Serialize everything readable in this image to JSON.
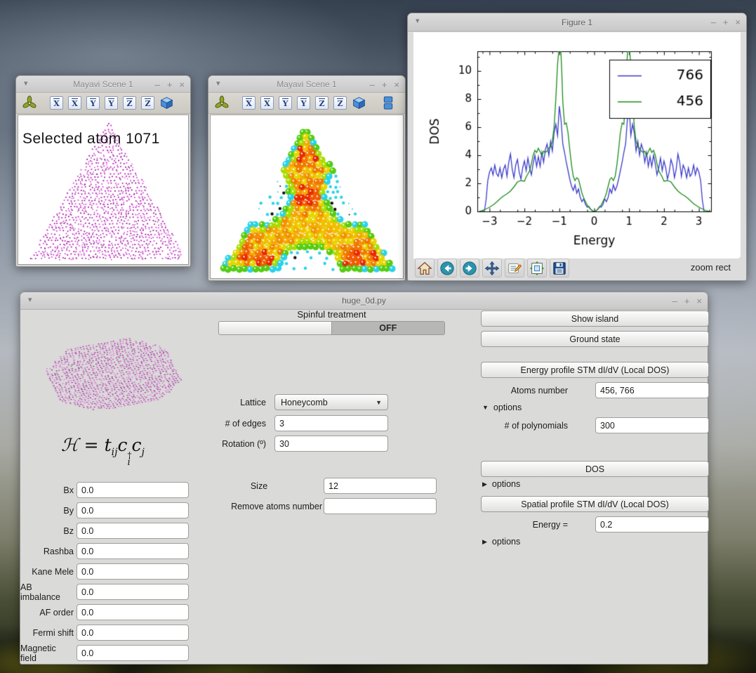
{
  "icons": {
    "minimize": "–",
    "maximize": "+",
    "close": "×",
    "menu": "▾",
    "expander_open": "▼",
    "expander_closed": "▶",
    "combo_arrow": "▼"
  },
  "mayavi1": {
    "title": "Mayavi Scene 1",
    "scene_text": "Selected atom 1071",
    "axis_letters": [
      "X",
      "X",
      "Y",
      "Y",
      "Z",
      "Z"
    ],
    "dot_color": "#c315c3"
  },
  "mayavi2": {
    "title": "Mayavi Scene 1",
    "axis_letters": [
      "X",
      "X",
      "Y",
      "Y",
      "Z",
      "Z"
    ]
  },
  "figure": {
    "title": "Figure 1",
    "status": "zoom rect"
  },
  "chart_data": {
    "type": "line",
    "title": "",
    "xlabel": "Energy",
    "ylabel": "DOS",
    "xlim": [
      -3.35,
      3.35
    ],
    "ylim": [
      0,
      11.4
    ],
    "xticks": [
      -3,
      -2,
      -1,
      0,
      1,
      2,
      3
    ],
    "xtick_labels": [
      "−3",
      "−2",
      "−1",
      "0",
      "1",
      "2",
      "3"
    ],
    "yticks": [
      0,
      2,
      4,
      6,
      8,
      10
    ],
    "ytick_labels": [
      "0",
      "2",
      "4",
      "6",
      "8",
      "10"
    ],
    "grid": false,
    "legend_position": "upper right",
    "symmetric_about_x0": true,
    "series": [
      {
        "name": "766",
        "color": "#3a3acc",
        "x_half": [
          -3.15,
          -3.1,
          -3.05,
          -3.0,
          -2.95,
          -2.9,
          -2.85,
          -2.8,
          -2.75,
          -2.7,
          -2.65,
          -2.6,
          -2.55,
          -2.5,
          -2.45,
          -2.4,
          -2.35,
          -2.3,
          -2.25,
          -2.2,
          -2.15,
          -2.1,
          -2.05,
          -2.0,
          -1.95,
          -1.9,
          -1.85,
          -1.8,
          -1.75,
          -1.7,
          -1.65,
          -1.6,
          -1.55,
          -1.5,
          -1.45,
          -1.4,
          -1.35,
          -1.3,
          -1.25,
          -1.2,
          -1.15,
          -1.1,
          -1.05,
          -1.0,
          -0.95,
          -0.9,
          -0.85,
          -0.8,
          -0.75,
          -0.7,
          -0.65,
          -0.6,
          -0.55,
          -0.5,
          -0.45,
          -0.4,
          -0.35,
          -0.3,
          -0.25,
          -0.2,
          -0.15,
          -0.1,
          -0.05,
          0.0
        ],
        "y_half": [
          0.0,
          0.8,
          2.2,
          2.8,
          3.1,
          2.6,
          3.3,
          2.7,
          2.5,
          3.1,
          2.4,
          3.0,
          3.3,
          2.5,
          3.5,
          4.1,
          3.0,
          2.4,
          3.3,
          3.7,
          2.8,
          2.3,
          3.1,
          3.6,
          2.9,
          3.8,
          3.1,
          2.6,
          3.4,
          4.0,
          3.2,
          3.9,
          3.2,
          4.2,
          3.5,
          4.4,
          4.8,
          4.0,
          5.0,
          4.3,
          5.6,
          6.2,
          5.4,
          7.5,
          6.5,
          4.8,
          4.2,
          3.5,
          2.9,
          2.3,
          1.8,
          1.5,
          1.9,
          1.3,
          1.6,
          1.0,
          0.7,
          0.9,
          0.5,
          0.3,
          0.35,
          0.15,
          0.05,
          0.0
        ]
      },
      {
        "name": "456",
        "color": "#1a8c1a",
        "x_half": [
          -3.3,
          -3.2,
          -3.0,
          -2.85,
          -2.7,
          -2.6,
          -2.5,
          -2.4,
          -2.3,
          -2.2,
          -2.1,
          -2.0,
          -1.95,
          -1.85,
          -1.8,
          -1.75,
          -1.7,
          -1.65,
          -1.6,
          -1.55,
          -1.5,
          -1.45,
          -1.4,
          -1.35,
          -1.3,
          -1.25,
          -1.2,
          -1.15,
          -1.1,
          -1.05,
          -1.0,
          -0.97,
          -0.93,
          -0.9,
          -0.85,
          -0.8,
          -0.75,
          -0.7,
          -0.65,
          -0.6,
          -0.55,
          -0.5,
          -0.45,
          -0.4,
          -0.35,
          -0.3,
          -0.25,
          -0.2,
          -0.15,
          -0.1,
          -0.05,
          0.0
        ],
        "y_half": [
          0.0,
          0.05,
          0.3,
          0.55,
          0.9,
          1.1,
          1.25,
          1.45,
          1.75,
          2.1,
          2.2,
          2.15,
          2.45,
          2.9,
          3.4,
          4.0,
          4.35,
          4.2,
          4.5,
          4.25,
          3.95,
          4.3,
          4.2,
          4.3,
          4.5,
          4.6,
          5.0,
          6.0,
          8.0,
          10.5,
          11.8,
          12.2,
          10.0,
          7.8,
          6.2,
          6.3,
          5.6,
          4.4,
          3.3,
          2.5,
          2.2,
          2.4,
          2.3,
          1.8,
          1.3,
          0.95,
          0.7,
          0.45,
          0.3,
          0.15,
          0.05,
          0.0
        ]
      }
    ]
  },
  "app": {
    "title": "huge_0d.py",
    "spinful_label": "Spinful treatment",
    "toggle_state": "OFF",
    "formula": {
      "H": "ℋ",
      "eq": " = ",
      "t": "t",
      "t_sub": "ij",
      "c1": "c",
      "dag": "†",
      "i_sub": "i",
      "c2": "c",
      "j_sub": "j"
    },
    "lattice": {
      "label": "Lattice",
      "value": "Honeycomb"
    },
    "edges": {
      "label": "# of edges",
      "value": "3"
    },
    "rotation": {
      "label": "Rotation (º)",
      "value": "30"
    },
    "size": {
      "label": "Size",
      "value": "12"
    },
    "remove": {
      "label": "Remove atoms number",
      "value": ""
    },
    "fields": [
      {
        "label": "Bx",
        "value": "0.0"
      },
      {
        "label": "By",
        "value": "0.0"
      },
      {
        "label": "Bz",
        "value": "0.0"
      },
      {
        "label": "Rashba",
        "value": "0.0"
      },
      {
        "label": "Kane Mele",
        "value": "0.0"
      },
      {
        "label": "AB imbalance",
        "value": "0.0"
      },
      {
        "label": "AF order",
        "value": "0.0"
      },
      {
        "label": "Fermi shift",
        "value": "0.0"
      },
      {
        "label": "Magnetic field",
        "value": "0.0"
      }
    ],
    "right": {
      "show_island": "Show island",
      "ground_state": "Ground state",
      "energy_profile": "Energy profile STM dI/dV (Local DOS)",
      "atoms_number_label": "Atoms number",
      "atoms_number_value": "456, 766",
      "options1": "options",
      "polynomials_label": "# of polynomials",
      "polynomials_value": "300",
      "dos": "DOS",
      "options2": "options",
      "spatial_profile": "Spatial profile STM dI/dV (Local DOS)",
      "energy_label": "Energy =",
      "energy_value": "0.2",
      "options3": "options"
    }
  }
}
